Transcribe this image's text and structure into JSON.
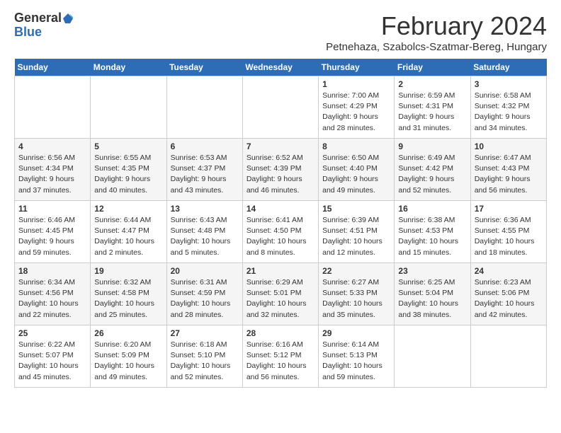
{
  "logo": {
    "general": "General",
    "blue": "Blue"
  },
  "header": {
    "month_title": "February 2024",
    "location": "Petnehaza, Szabolcs-Szatmar-Bereg, Hungary"
  },
  "weekdays": [
    "Sunday",
    "Monday",
    "Tuesday",
    "Wednesday",
    "Thursday",
    "Friday",
    "Saturday"
  ],
  "weeks": [
    [
      {
        "day": "",
        "info": ""
      },
      {
        "day": "",
        "info": ""
      },
      {
        "day": "",
        "info": ""
      },
      {
        "day": "",
        "info": ""
      },
      {
        "day": "1",
        "info": "Sunrise: 7:00 AM\nSunset: 4:29 PM\nDaylight: 9 hours\nand 28 minutes."
      },
      {
        "day": "2",
        "info": "Sunrise: 6:59 AM\nSunset: 4:31 PM\nDaylight: 9 hours\nand 31 minutes."
      },
      {
        "day": "3",
        "info": "Sunrise: 6:58 AM\nSunset: 4:32 PM\nDaylight: 9 hours\nand 34 minutes."
      }
    ],
    [
      {
        "day": "4",
        "info": "Sunrise: 6:56 AM\nSunset: 4:34 PM\nDaylight: 9 hours\nand 37 minutes."
      },
      {
        "day": "5",
        "info": "Sunrise: 6:55 AM\nSunset: 4:35 PM\nDaylight: 9 hours\nand 40 minutes."
      },
      {
        "day": "6",
        "info": "Sunrise: 6:53 AM\nSunset: 4:37 PM\nDaylight: 9 hours\nand 43 minutes."
      },
      {
        "day": "7",
        "info": "Sunrise: 6:52 AM\nSunset: 4:39 PM\nDaylight: 9 hours\nand 46 minutes."
      },
      {
        "day": "8",
        "info": "Sunrise: 6:50 AM\nSunset: 4:40 PM\nDaylight: 9 hours\nand 49 minutes."
      },
      {
        "day": "9",
        "info": "Sunrise: 6:49 AM\nSunset: 4:42 PM\nDaylight: 9 hours\nand 52 minutes."
      },
      {
        "day": "10",
        "info": "Sunrise: 6:47 AM\nSunset: 4:43 PM\nDaylight: 9 hours\nand 56 minutes."
      }
    ],
    [
      {
        "day": "11",
        "info": "Sunrise: 6:46 AM\nSunset: 4:45 PM\nDaylight: 9 hours\nand 59 minutes."
      },
      {
        "day": "12",
        "info": "Sunrise: 6:44 AM\nSunset: 4:47 PM\nDaylight: 10 hours\nand 2 minutes."
      },
      {
        "day": "13",
        "info": "Sunrise: 6:43 AM\nSunset: 4:48 PM\nDaylight: 10 hours\nand 5 minutes."
      },
      {
        "day": "14",
        "info": "Sunrise: 6:41 AM\nSunset: 4:50 PM\nDaylight: 10 hours\nand 8 minutes."
      },
      {
        "day": "15",
        "info": "Sunrise: 6:39 AM\nSunset: 4:51 PM\nDaylight: 10 hours\nand 12 minutes."
      },
      {
        "day": "16",
        "info": "Sunrise: 6:38 AM\nSunset: 4:53 PM\nDaylight: 10 hours\nand 15 minutes."
      },
      {
        "day": "17",
        "info": "Sunrise: 6:36 AM\nSunset: 4:55 PM\nDaylight: 10 hours\nand 18 minutes."
      }
    ],
    [
      {
        "day": "18",
        "info": "Sunrise: 6:34 AM\nSunset: 4:56 PM\nDaylight: 10 hours\nand 22 minutes."
      },
      {
        "day": "19",
        "info": "Sunrise: 6:32 AM\nSunset: 4:58 PM\nDaylight: 10 hours\nand 25 minutes."
      },
      {
        "day": "20",
        "info": "Sunrise: 6:31 AM\nSunset: 4:59 PM\nDaylight: 10 hours\nand 28 minutes."
      },
      {
        "day": "21",
        "info": "Sunrise: 6:29 AM\nSunset: 5:01 PM\nDaylight: 10 hours\nand 32 minutes."
      },
      {
        "day": "22",
        "info": "Sunrise: 6:27 AM\nSunset: 5:33 PM\nDaylight: 10 hours\nand 35 minutes."
      },
      {
        "day": "23",
        "info": "Sunrise: 6:25 AM\nSunset: 5:04 PM\nDaylight: 10 hours\nand 38 minutes."
      },
      {
        "day": "24",
        "info": "Sunrise: 6:23 AM\nSunset: 5:06 PM\nDaylight: 10 hours\nand 42 minutes."
      }
    ],
    [
      {
        "day": "25",
        "info": "Sunrise: 6:22 AM\nSunset: 5:07 PM\nDaylight: 10 hours\nand 45 minutes."
      },
      {
        "day": "26",
        "info": "Sunrise: 6:20 AM\nSunset: 5:09 PM\nDaylight: 10 hours\nand 49 minutes."
      },
      {
        "day": "27",
        "info": "Sunrise: 6:18 AM\nSunset: 5:10 PM\nDaylight: 10 hours\nand 52 minutes."
      },
      {
        "day": "28",
        "info": "Sunrise: 6:16 AM\nSunset: 5:12 PM\nDaylight: 10 hours\nand 56 minutes."
      },
      {
        "day": "29",
        "info": "Sunrise: 6:14 AM\nSunset: 5:13 PM\nDaylight: 10 hours\nand 59 minutes."
      },
      {
        "day": "",
        "info": ""
      },
      {
        "day": "",
        "info": ""
      }
    ]
  ]
}
